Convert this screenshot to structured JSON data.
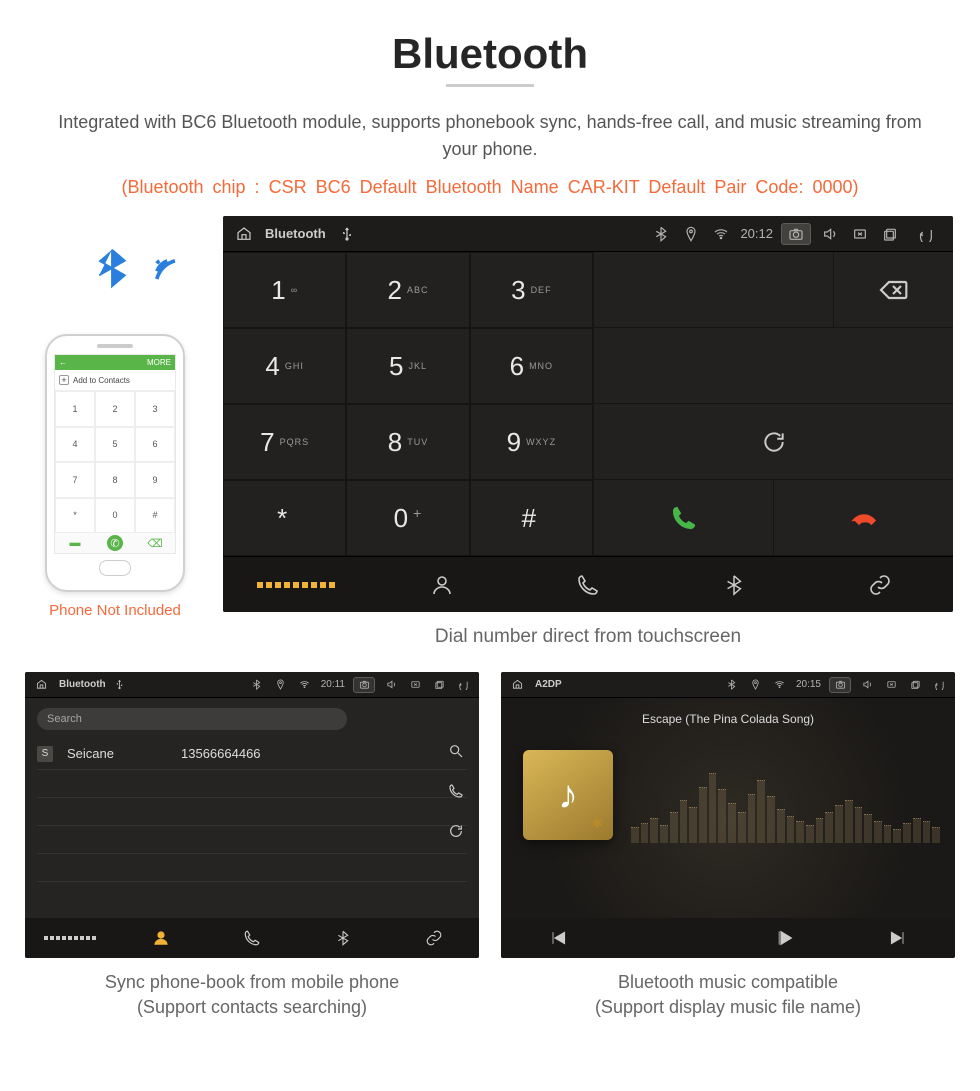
{
  "header": {
    "title": "Bluetooth",
    "subtitle": "Integrated with BC6 Bluetooth module, supports phonebook sync, hands-free call, and music streaming from your phone.",
    "chips": "(Bluetooth chip : CSR BC6    Default Bluetooth Name CAR-KIT    Default Pair Code: 0000)"
  },
  "phone": {
    "green_bar_left": "←",
    "green_bar_right": "MORE",
    "add_contacts": "Add to Contacts",
    "keys": [
      "1",
      "2",
      "3",
      "4",
      "5",
      "6",
      "7",
      "8",
      "9",
      "*",
      "0",
      "#"
    ],
    "caption": "Phone Not Included"
  },
  "dialer": {
    "topbar": {
      "title": "Bluetooth",
      "time": "20:12"
    },
    "keys": [
      {
        "n": "1",
        "l": "∞"
      },
      {
        "n": "2",
        "l": "ABC"
      },
      {
        "n": "3",
        "l": "DEF"
      },
      {
        "n": "4",
        "l": "GHI"
      },
      {
        "n": "5",
        "l": "JKL"
      },
      {
        "n": "6",
        "l": "MNO"
      },
      {
        "n": "7",
        "l": "PQRS"
      },
      {
        "n": "8",
        "l": "TUV"
      },
      {
        "n": "9",
        "l": "WXYZ"
      },
      {
        "n": "*",
        "l": ""
      },
      {
        "n": "0",
        "l": "+"
      },
      {
        "n": "#",
        "l": ""
      }
    ],
    "caption": "Dial number direct from touchscreen"
  },
  "phonebook": {
    "topbar": {
      "title": "Bluetooth",
      "time": "20:11"
    },
    "search_placeholder": "Search",
    "contact": {
      "tag": "S",
      "name": "Seicane",
      "number": "13566664466"
    },
    "caption_l1": "Sync phone-book from mobile phone",
    "caption_l2": "(Support contacts searching)"
  },
  "music": {
    "topbar": {
      "title": "A2DP",
      "time": "20:15"
    },
    "song": "Escape (The Pina Colada Song)",
    "caption_l1": "Bluetooth music compatible",
    "caption_l2": "(Support display music file name)"
  },
  "colors": {
    "accent_orange": "#f56a3a",
    "accent_yellow": "#f0b335",
    "call_green": "#47b648",
    "hangup": "#f04a2c"
  }
}
